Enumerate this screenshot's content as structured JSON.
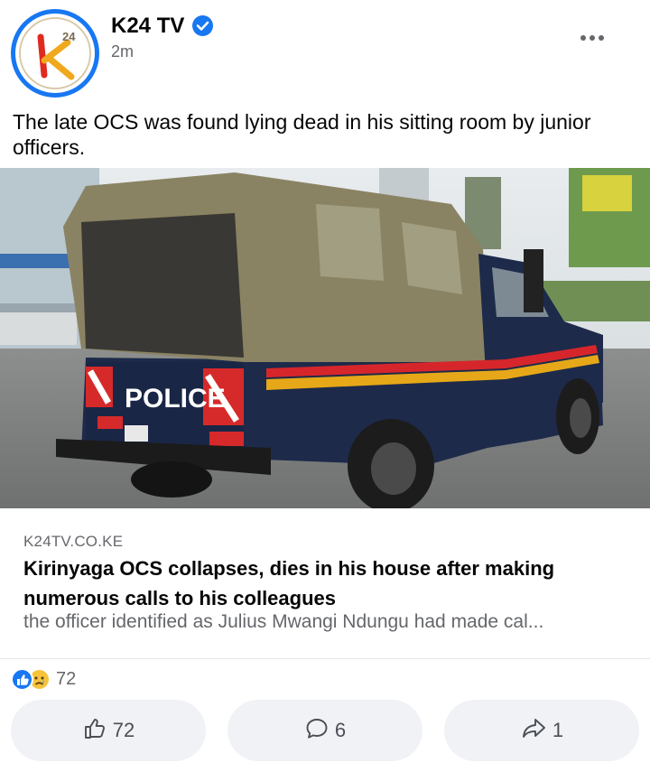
{
  "post": {
    "page_name": "K24 TV",
    "timestamp": "2m",
    "verified_icon": "verified-badge-icon",
    "more_icon": "more-options-icon",
    "caption": "The late OCS was found lying dead in his sitting room by junior officers."
  },
  "avatar": {
    "logo_text": "24",
    "logo_letter": "K"
  },
  "photo": {
    "vehicle_label": "POLICE"
  },
  "link_preview": {
    "domain": "K24TV.CO.KE",
    "title": "Kirinyaga OCS collapses, dies in his house after making numerous calls to his colleagues",
    "description": "the officer identified as Julius Mwangi Ndungu had made cal..."
  },
  "reactions": {
    "icons": [
      "like-reaction-icon",
      "sad-reaction-icon"
    ],
    "count": "72"
  },
  "actions": {
    "like": {
      "icon": "thumbs-up-icon",
      "label": "72"
    },
    "comment": {
      "icon": "comment-icon",
      "label": "6"
    },
    "share": {
      "icon": "share-icon",
      "label": "1"
    }
  },
  "colors": {
    "accent": "#1877f2",
    "secondary_text": "#65676b",
    "button_bg": "#f0f2f5"
  }
}
